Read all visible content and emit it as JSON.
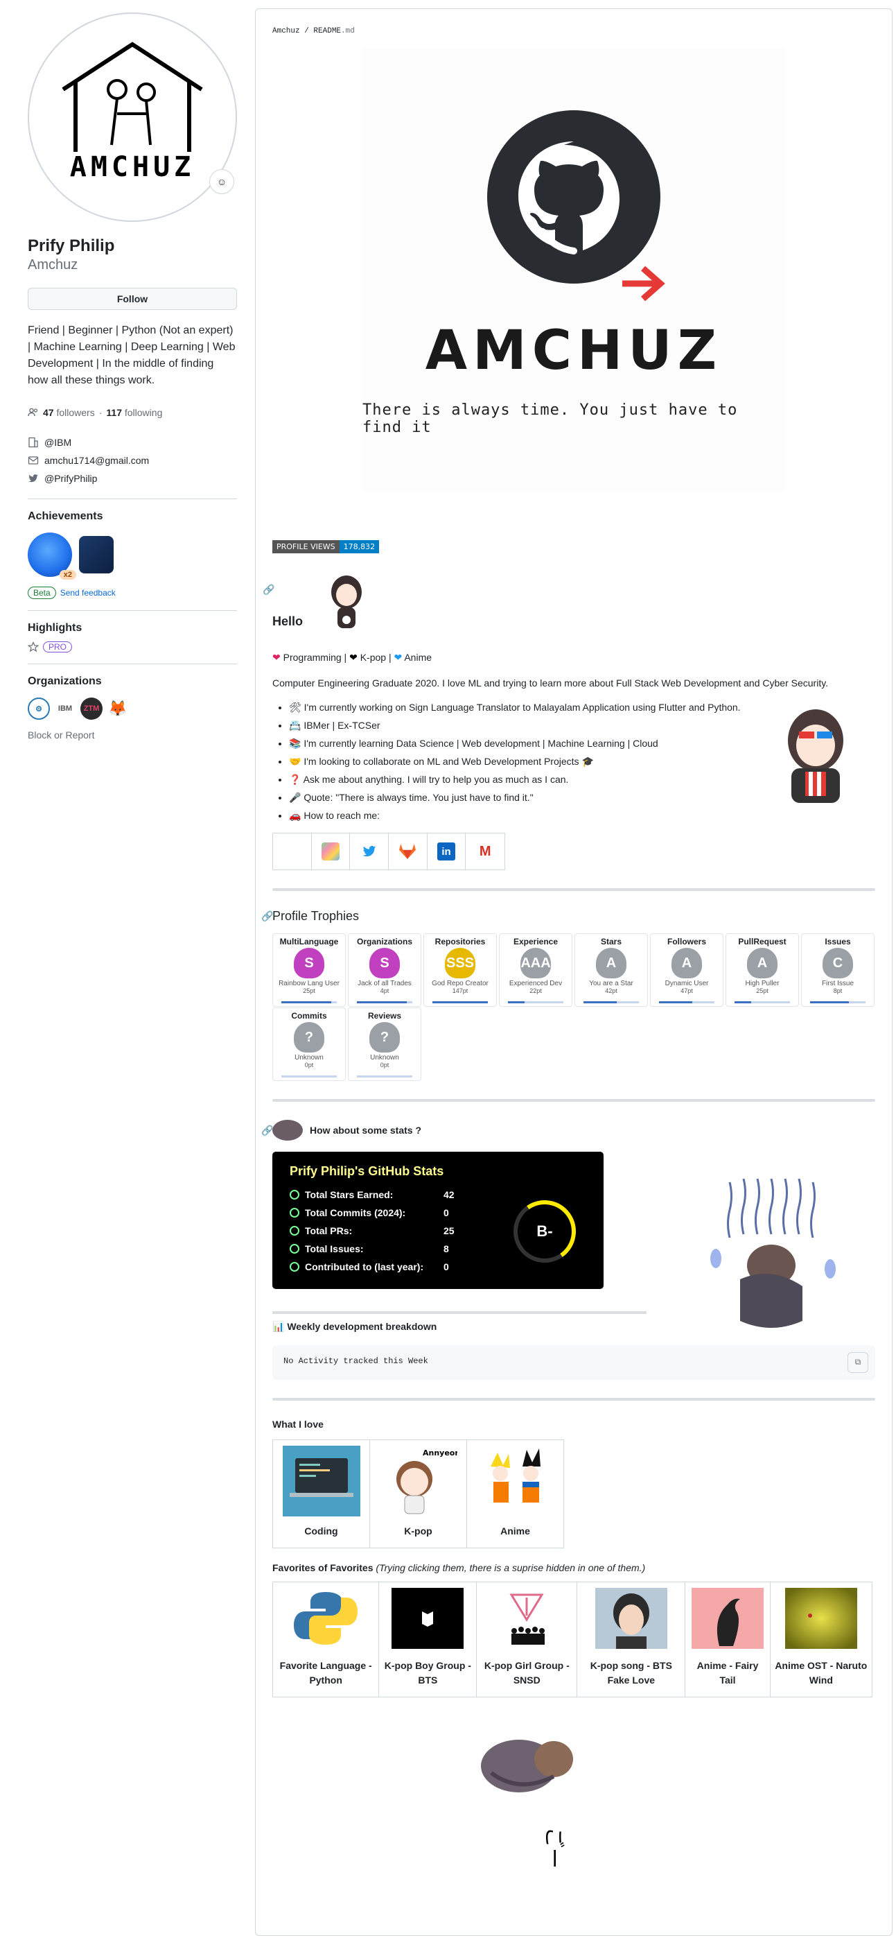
{
  "profile": {
    "fullname": "Prify Philip",
    "login": "Amchuz",
    "follow_label": "Follow",
    "bio": "Friend | Beginner | Python (Not an expert) | Machine Learning | Deep Learning | Web Development | In the middle of finding how all these things work.",
    "followers_count": "47",
    "followers_label": "followers",
    "separator": "·",
    "following_count": "117",
    "following_label": "following",
    "company": "@IBM",
    "email": "amchu1714@gmail.com",
    "twitter": "@PrifyPhilip"
  },
  "achievements": {
    "title": "Achievements",
    "multiplier": "x2",
    "beta_label": "Beta",
    "feedback_label": "Send feedback"
  },
  "highlights": {
    "title": "Highlights",
    "pro_label": "PRO"
  },
  "organizations": {
    "title": "Organizations",
    "org_labels": [
      "IBM",
      "ZTM"
    ]
  },
  "block_report": "Block or Report",
  "readme": {
    "path_user": "Amchuz",
    "path_sep": " / ",
    "path_file": "README",
    "path_ext": ".md",
    "banner_title": "AMCHUZ",
    "banner_tagline": "There is always time. You just have to find it",
    "views_label": "PROFILE VIEWS",
    "views_count": "178,832",
    "hello": "Hello",
    "loves": [
      "Programming",
      "K-pop",
      "Anime"
    ],
    "intro": "Computer Engineering Graduate 2020. I love ML and trying to learn more about Full Stack Web Development and Cyber Security.",
    "list": [
      "I'm currently working on Sign Language Translator to Malayalam Application using Flutter and Python.",
      "IBMer | Ex-TCSer",
      "I'm currently learning Data Science | Web development | Machine Learning | Cloud",
      "I'm looking to collaborate on ML and Web Development Projects",
      "Ask me about anything. I will try to help you as much as I can.",
      "Quote: \"There is always time. You just have to find it.\"",
      "How to reach me:"
    ],
    "trophies_title": "Profile Trophies",
    "trophies": [
      {
        "title": "MultiLanguage",
        "rank": "S",
        "name": "Rainbow Lang User",
        "pt": "25pt",
        "color": "#c040c0",
        "progress": 0.9
      },
      {
        "title": "Organizations",
        "rank": "S",
        "name": "Jack of all Trades",
        "pt": "4pt",
        "color": "#c040c0",
        "progress": 0.9
      },
      {
        "title": "Repositories",
        "rank": "SSS",
        "name": "God Repo Creator",
        "pt": "147pt",
        "color": "#e6b800",
        "progress": 1.0
      },
      {
        "title": "Experience",
        "rank": "AAA",
        "name": "Experienced Dev",
        "pt": "22pt",
        "color": "#9aa0a6",
        "progress": 0.3
      },
      {
        "title": "Stars",
        "rank": "A",
        "name": "You are a Star",
        "pt": "42pt",
        "color": "#9aa0a6",
        "progress": 0.6
      },
      {
        "title": "Followers",
        "rank": "A",
        "name": "Dynamic User",
        "pt": "47pt",
        "color": "#9aa0a6",
        "progress": 0.6
      },
      {
        "title": "PullRequest",
        "rank": "A",
        "name": "High Puller",
        "pt": "25pt",
        "color": "#9aa0a6",
        "progress": 0.3
      },
      {
        "title": "Issues",
        "rank": "C",
        "name": "First Issue",
        "pt": "8pt",
        "color": "#9aa0a6",
        "progress": 0.7
      },
      {
        "title": "Commits",
        "rank": "?",
        "name": "Unknown",
        "pt": "0pt",
        "color": "#9aa0a6",
        "progress": 0.0
      },
      {
        "title": "Reviews",
        "rank": "?",
        "name": "Unknown",
        "pt": "0pt",
        "color": "#9aa0a6",
        "progress": 0.0
      }
    ],
    "stats_heading": "How about some stats ?",
    "stats_card": {
      "title": "Prify Philip's GitHub Stats",
      "rows": [
        {
          "k": "Total Stars Earned:",
          "v": "42"
        },
        {
          "k": "Total Commits (2024):",
          "v": "0"
        },
        {
          "k": "Total PRs:",
          "v": "25"
        },
        {
          "k": "Total Issues:",
          "v": "8"
        },
        {
          "k": "Contributed to (last year):",
          "v": "0"
        }
      ],
      "rank": "B-"
    },
    "weekly_title": "Weekly development breakdown",
    "weekly_code": "No Activity tracked this Week",
    "what_i_love": "What I love",
    "love_items": [
      "Coding",
      "K-pop",
      "Anime"
    ],
    "kpop_image_text": "Annyeong",
    "fav_title": "Favorites of Favorites",
    "fav_note": "(Trying clicking them, there is a suprise hidden in one of them.)",
    "favorites": [
      "Favorite Language - Python",
      "K-pop Boy Group - BTS",
      "K-pop Girl Group - SNSD",
      "K-pop song - BTS Fake Love",
      "Anime - Fairy Tail",
      "Anime OST - Naruto Wind"
    ]
  },
  "colors": {
    "accent": "#0969da",
    "stats_title": "#fffd8b",
    "stats_icon": "#79ff97",
    "rank_ring": "#ffea00",
    "views_badge": "#007ec6"
  },
  "icons": [
    "people-icon",
    "building-icon",
    "mail-icon",
    "twitter-icon",
    "star-icon",
    "link-icon",
    "copy-icon",
    "heart-icon"
  ]
}
